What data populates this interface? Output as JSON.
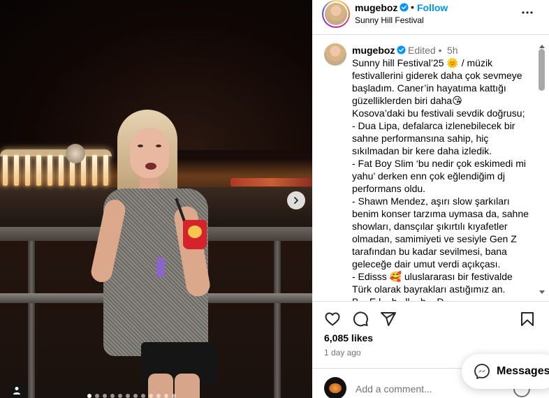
{
  "header": {
    "username": "mugeboz",
    "separator": "•",
    "follow_label": "Follow",
    "location": "Sunny Hill Festival"
  },
  "comment": {
    "username": "mugeboz",
    "edited": "Edited •",
    "time": "5h",
    "caption_lines": [
      "Sunny hill Festival’25 🌞 / müzik",
      "festivallerini giderek daha çok sevmeye",
      "başladım. Caner’in hayatıma kattığı",
      "güzelliklerden biri daha😘",
      "Kosova’daki bu festivali sevdik doğrusu;",
      "- Dua Lipa, defalarca izlenebilecek bir",
      "sahne performansına sahip, hiç",
      "sıkılmadan bir kere daha izledik.",
      "- Fat Boy Slim ‘bu nedir çok eskimedi mi",
      "yahu’ derken enn çok eğlendiğim dj",
      "performans oldu.",
      "- Shawn Mendez, aşırı slow şarkıları",
      "benim konser tarzıma uymasa da, sahne",
      "showları, dansçılar şıkırtılı kıyafetler",
      "olmadan, samimiyeti ve sesiyle  Gen Z",
      "tarafından bu kadar sevilmesi, bana",
      "geleceğe dair umut verdi açıkçası.",
      "- Edisss 🥰 uluslararası bir festivalde",
      "Türk olarak bayrakları astığımız an.",
      "B... E l... b...ll... b... D..."
    ]
  },
  "stats": {
    "likes": "6,085 likes",
    "posted": "1 day ago"
  },
  "add_comment": {
    "placeholder": "Add a comment..."
  },
  "messages": {
    "label": "Messages"
  },
  "colors": {
    "accent": "#0095f6",
    "secondary_text": "#737373",
    "border": "#dbdbdb"
  },
  "icons": [
    "verified-icon",
    "more-icon",
    "heart-icon",
    "comment-icon",
    "share-icon",
    "bookmark-icon",
    "emoji-icon",
    "messenger-icon",
    "chevron-right-icon",
    "person-tag-icon"
  ],
  "carousel": {
    "slide_count": 12,
    "active_index": 0
  }
}
